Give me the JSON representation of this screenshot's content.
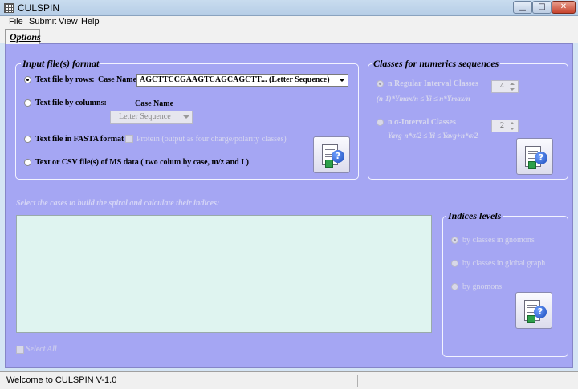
{
  "window": {
    "title": "CULSPIN"
  },
  "menu": [
    "File",
    "Submit",
    "View",
    "Help"
  ],
  "tab": {
    "label": "Options"
  },
  "input_format": {
    "title": "Input file(s) format",
    "rows_label": "Text file by rows:",
    "case_name_label": "Case Name",
    "case_name_value": "AGCTTCCGAAGTCAGCAGCTT...  (Letter Sequence)",
    "columns_label": "Text file by columns:",
    "columns_case_name_label": "Case Name",
    "columns_combo_value": "Letter Sequence",
    "fasta_label": "Text file in FASTA format",
    "protein_label": "Protein (output as four charge/polarity classes)",
    "csv_label": "Text or CSV file(s) of MS data  ( two colum by case, m/z and I )"
  },
  "classes": {
    "title": "Classes for numerics sequences",
    "regular_label": "n  Regular Interval Classes",
    "regular_value": "4",
    "regular_formula": "(n-1)*Ymax/n ≤ Yi ≤ n*Ymax/n",
    "sigma_label": "n σ-Interval Classes",
    "sigma_value": "2",
    "sigma_formula": "Yavg-n*σ/2 ≤ Yi ≤ Yavg+n*σ/2"
  },
  "cases": {
    "instruction": "Select the cases to build the spiral and calculate their indices:",
    "select_all": "Select All"
  },
  "indices": {
    "title": "Indices levels",
    "option1": "by classes in gnomons",
    "option2": "by classes in global graph",
    "option3": "by gnomons"
  },
  "status": {
    "text": "Welcome to CULSPIN V-1.0"
  }
}
